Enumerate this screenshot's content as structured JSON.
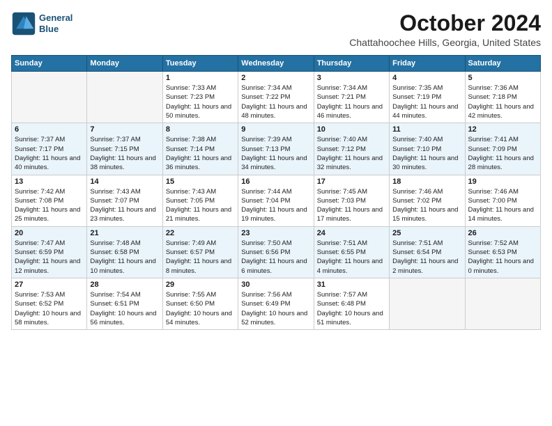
{
  "header": {
    "logo_line1": "General",
    "logo_line2": "Blue",
    "month": "October 2024",
    "location": "Chattahoochee Hills, Georgia, United States"
  },
  "weekdays": [
    "Sunday",
    "Monday",
    "Tuesday",
    "Wednesday",
    "Thursday",
    "Friday",
    "Saturday"
  ],
  "weeks": [
    [
      {
        "day": "",
        "info": ""
      },
      {
        "day": "",
        "info": ""
      },
      {
        "day": "1",
        "info": "Sunrise: 7:33 AM\nSunset: 7:23 PM\nDaylight: 11 hours and 50 minutes."
      },
      {
        "day": "2",
        "info": "Sunrise: 7:34 AM\nSunset: 7:22 PM\nDaylight: 11 hours and 48 minutes."
      },
      {
        "day": "3",
        "info": "Sunrise: 7:34 AM\nSunset: 7:21 PM\nDaylight: 11 hours and 46 minutes."
      },
      {
        "day": "4",
        "info": "Sunrise: 7:35 AM\nSunset: 7:19 PM\nDaylight: 11 hours and 44 minutes."
      },
      {
        "day": "5",
        "info": "Sunrise: 7:36 AM\nSunset: 7:18 PM\nDaylight: 11 hours and 42 minutes."
      }
    ],
    [
      {
        "day": "6",
        "info": "Sunrise: 7:37 AM\nSunset: 7:17 PM\nDaylight: 11 hours and 40 minutes."
      },
      {
        "day": "7",
        "info": "Sunrise: 7:37 AM\nSunset: 7:15 PM\nDaylight: 11 hours and 38 minutes."
      },
      {
        "day": "8",
        "info": "Sunrise: 7:38 AM\nSunset: 7:14 PM\nDaylight: 11 hours and 36 minutes."
      },
      {
        "day": "9",
        "info": "Sunrise: 7:39 AM\nSunset: 7:13 PM\nDaylight: 11 hours and 34 minutes."
      },
      {
        "day": "10",
        "info": "Sunrise: 7:40 AM\nSunset: 7:12 PM\nDaylight: 11 hours and 32 minutes."
      },
      {
        "day": "11",
        "info": "Sunrise: 7:40 AM\nSunset: 7:10 PM\nDaylight: 11 hours and 30 minutes."
      },
      {
        "day": "12",
        "info": "Sunrise: 7:41 AM\nSunset: 7:09 PM\nDaylight: 11 hours and 28 minutes."
      }
    ],
    [
      {
        "day": "13",
        "info": "Sunrise: 7:42 AM\nSunset: 7:08 PM\nDaylight: 11 hours and 25 minutes."
      },
      {
        "day": "14",
        "info": "Sunrise: 7:43 AM\nSunset: 7:07 PM\nDaylight: 11 hours and 23 minutes."
      },
      {
        "day": "15",
        "info": "Sunrise: 7:43 AM\nSunset: 7:05 PM\nDaylight: 11 hours and 21 minutes."
      },
      {
        "day": "16",
        "info": "Sunrise: 7:44 AM\nSunset: 7:04 PM\nDaylight: 11 hours and 19 minutes."
      },
      {
        "day": "17",
        "info": "Sunrise: 7:45 AM\nSunset: 7:03 PM\nDaylight: 11 hours and 17 minutes."
      },
      {
        "day": "18",
        "info": "Sunrise: 7:46 AM\nSunset: 7:02 PM\nDaylight: 11 hours and 15 minutes."
      },
      {
        "day": "19",
        "info": "Sunrise: 7:46 AM\nSunset: 7:00 PM\nDaylight: 11 hours and 14 minutes."
      }
    ],
    [
      {
        "day": "20",
        "info": "Sunrise: 7:47 AM\nSunset: 6:59 PM\nDaylight: 11 hours and 12 minutes."
      },
      {
        "day": "21",
        "info": "Sunrise: 7:48 AM\nSunset: 6:58 PM\nDaylight: 11 hours and 10 minutes."
      },
      {
        "day": "22",
        "info": "Sunrise: 7:49 AM\nSunset: 6:57 PM\nDaylight: 11 hours and 8 minutes."
      },
      {
        "day": "23",
        "info": "Sunrise: 7:50 AM\nSunset: 6:56 PM\nDaylight: 11 hours and 6 minutes."
      },
      {
        "day": "24",
        "info": "Sunrise: 7:51 AM\nSunset: 6:55 PM\nDaylight: 11 hours and 4 minutes."
      },
      {
        "day": "25",
        "info": "Sunrise: 7:51 AM\nSunset: 6:54 PM\nDaylight: 11 hours and 2 minutes."
      },
      {
        "day": "26",
        "info": "Sunrise: 7:52 AM\nSunset: 6:53 PM\nDaylight: 11 hours and 0 minutes."
      }
    ],
    [
      {
        "day": "27",
        "info": "Sunrise: 7:53 AM\nSunset: 6:52 PM\nDaylight: 10 hours and 58 minutes."
      },
      {
        "day": "28",
        "info": "Sunrise: 7:54 AM\nSunset: 6:51 PM\nDaylight: 10 hours and 56 minutes."
      },
      {
        "day": "29",
        "info": "Sunrise: 7:55 AM\nSunset: 6:50 PM\nDaylight: 10 hours and 54 minutes."
      },
      {
        "day": "30",
        "info": "Sunrise: 7:56 AM\nSunset: 6:49 PM\nDaylight: 10 hours and 52 minutes."
      },
      {
        "day": "31",
        "info": "Sunrise: 7:57 AM\nSunset: 6:48 PM\nDaylight: 10 hours and 51 minutes."
      },
      {
        "day": "",
        "info": ""
      },
      {
        "day": "",
        "info": ""
      }
    ]
  ]
}
